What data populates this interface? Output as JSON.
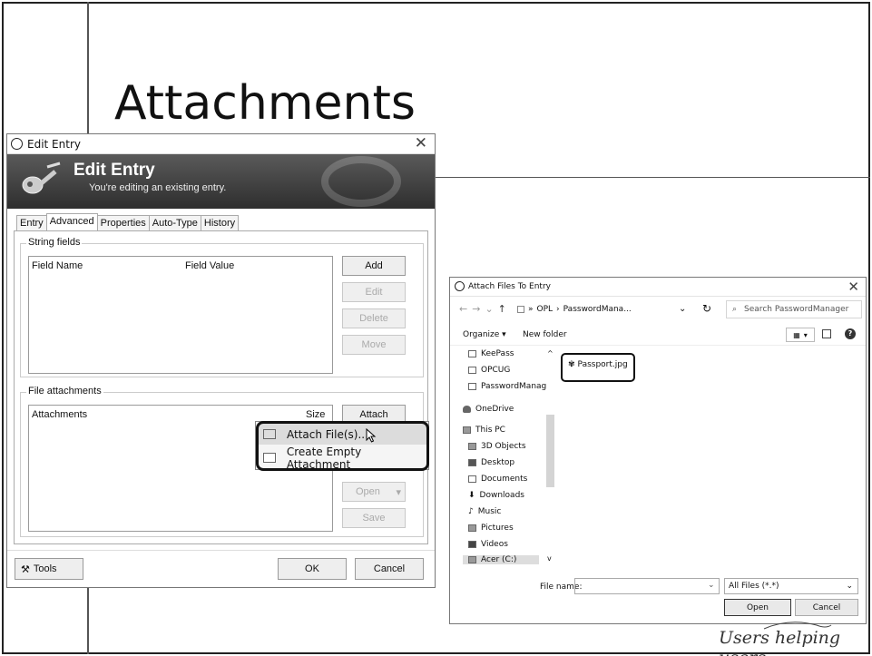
{
  "slide": {
    "title": "Attachments",
    "brand": "Users helping users"
  },
  "edit_entry": {
    "window_title": "Edit Entry",
    "banner_title": "Edit Entry",
    "banner_subtitle": "You're editing an existing entry.",
    "tabs": [
      "Entry",
      "Advanced",
      "Properties",
      "Auto-Type",
      "History"
    ],
    "active_tab": "Advanced",
    "string_fields": {
      "group_title": "String fields",
      "columns": [
        "Field Name",
        "Field Value"
      ],
      "buttons": {
        "add": "Add",
        "edit": "Edit",
        "delete": "Delete",
        "move": "Move"
      }
    },
    "file_attachments": {
      "group_title": "File attachments",
      "columns": [
        "Attachments",
        "Size"
      ],
      "buttons": {
        "attach": "Attach",
        "open": "Open",
        "save": "Save"
      }
    },
    "context_menu": {
      "items": [
        "Attach File(s)...",
        "Create Empty Attachment"
      ]
    },
    "footer": {
      "tools": "Tools",
      "ok": "OK",
      "cancel": "Cancel"
    }
  },
  "attach_dialog": {
    "window_title": "Attach Files To Entry",
    "address": {
      "parts": [
        "OPL",
        "PasswordMana..."
      ]
    },
    "search_placeholder": "Search PasswordManager",
    "toolbar": {
      "organize": "Organize ▾",
      "new_folder": "New folder"
    },
    "nav_items": [
      "KeePass",
      "OPCUG",
      "PasswordManag",
      "OneDrive",
      "This PC",
      "3D Objects",
      "Desktop",
      "Documents",
      "Downloads",
      "Music",
      "Pictures",
      "Videos",
      "Acer (C:)"
    ],
    "files": [
      "Passport.jpg"
    ],
    "file_name_label": "File name:",
    "file_name_value": "",
    "file_type": "All Files (*.*)",
    "buttons": {
      "open": "Open",
      "cancel": "Cancel"
    }
  }
}
